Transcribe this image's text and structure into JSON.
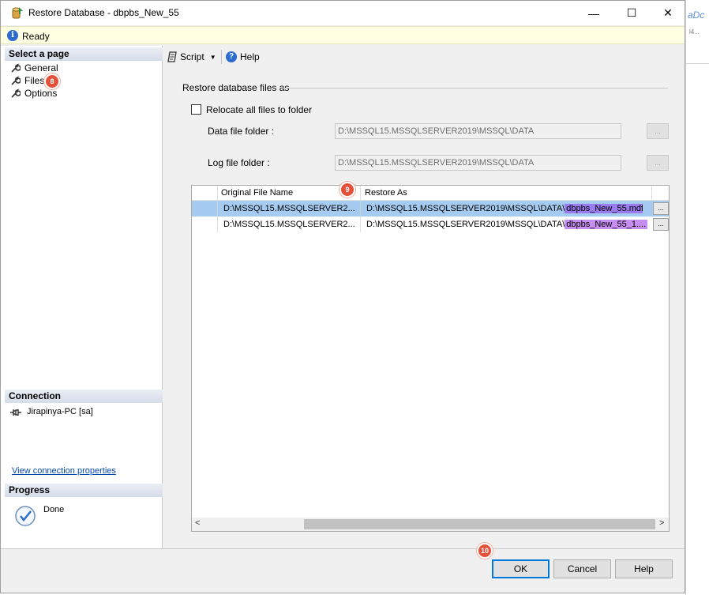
{
  "background_app": {
    "text1": "aDc",
    "text2": "l4..."
  },
  "window": {
    "title": "Restore Database - dbpbs_New_55",
    "minimize": "—",
    "maximize": "☐",
    "close": "✕"
  },
  "status": {
    "icon": "info-icon",
    "text": "Ready"
  },
  "left_pane": {
    "select_page_header": "Select a page",
    "pages": [
      {
        "label": "General"
      },
      {
        "label": "Files",
        "badge": "8"
      },
      {
        "label": "Options"
      }
    ],
    "connection_header": "Connection",
    "connection_value": "Jirapinya-PC [sa]",
    "view_connection_link": "View connection properties",
    "progress_header": "Progress",
    "progress_status": "Done"
  },
  "toolbar": {
    "script_label": "Script",
    "help_label": "Help"
  },
  "content": {
    "group_title": "Restore database files as",
    "relocate_label": "Relocate all files to folder",
    "relocate_checked": false,
    "data_folder_label": "Data file folder :",
    "data_folder_value": "D:\\MSSQL15.MSSQLSERVER2019\\MSSQL\\DATA",
    "log_folder_label": "Log file folder :",
    "log_folder_value": "D:\\MSSQL15.MSSQLSERVER2019\\MSSQL\\DATA",
    "browse_label": "...",
    "grid": {
      "columns": [
        "Original File Name",
        "Restore As"
      ],
      "header_badge": "9",
      "rows": [
        {
          "original": "D:\\MSSQL15.MSSQLSERVER2...",
          "restore_path": "D:\\MSSQL15.MSSQLSERVER2019\\MSSQL\\DATA\\",
          "restore_file": "dbpbs_New_55.mdf",
          "selected": true
        },
        {
          "original": "D:\\MSSQL15.MSSQLSERVER2...",
          "restore_path": "D:\\MSSQL15.MSSQLSERVER2019\\MSSQL\\DATA\\",
          "restore_file": "dbpbs_New_55_1....",
          "selected": false
        }
      ],
      "cell_button": "..."
    }
  },
  "footer": {
    "ok_badge": "10",
    "ok": "OK",
    "cancel": "Cancel",
    "help": "Help"
  },
  "colors": {
    "badge": "#e4513a",
    "selected_row": "#a6cbf0",
    "highlight_mdf": "#9a7bf0",
    "highlight_ldf": "#c68ef0",
    "link": "#0645ad"
  }
}
